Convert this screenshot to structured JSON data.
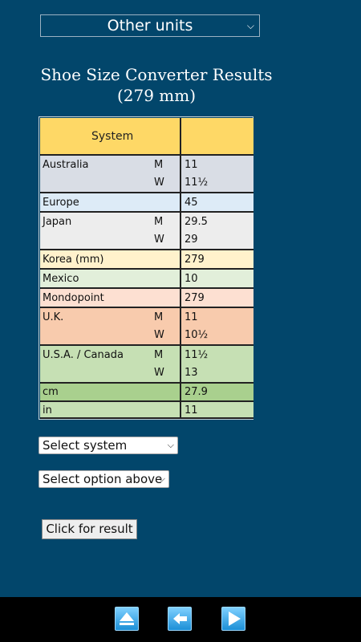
{
  "units_select": "Other units",
  "title_line1": "Shoe Size Converter Results",
  "title_line2": "(279 mm)",
  "table_header": "System",
  "rows": {
    "australia": {
      "label": "Australia",
      "m": "M",
      "w": "W",
      "m_val": "11",
      "w_val": "11½",
      "color": "#d9dde5"
    },
    "europe": {
      "label": "Europe",
      "val": "45",
      "color": "#ddebf7"
    },
    "japan": {
      "label": "Japan",
      "m": "M",
      "w": "W",
      "m_val": "29.5",
      "w_val": "29",
      "color": "#ededed"
    },
    "korea": {
      "label": "Korea (mm)",
      "val": "279",
      "color": "#fff2cc"
    },
    "mexico": {
      "label": "Mexico",
      "val": "10",
      "color": "#e2efda"
    },
    "mondopoint": {
      "label": "Mondopoint",
      "val": "279",
      "color": "#fde0d2"
    },
    "uk": {
      "label": "U.K.",
      "m": "M",
      "w": "W",
      "m_val": "11",
      "w_val": "10½",
      "color": "#f8cbad"
    },
    "usa": {
      "label": "U.S.A. / Canada",
      "m": "M",
      "w": "W",
      "m_val": "11½",
      "w_val": "13",
      "color": "#c6e0b4"
    },
    "cm": {
      "label": "cm",
      "val": "27.9",
      "color": "#a9d08e"
    },
    "in": {
      "label": "in",
      "val": "11",
      "color": "#c6e0b4"
    }
  },
  "select_system": "Select system",
  "select_option": "Select option above",
  "result_button": "Click for result",
  "nav_icons": [
    "eject-icon",
    "back-arrow-icon",
    "forward-arrow-icon"
  ]
}
